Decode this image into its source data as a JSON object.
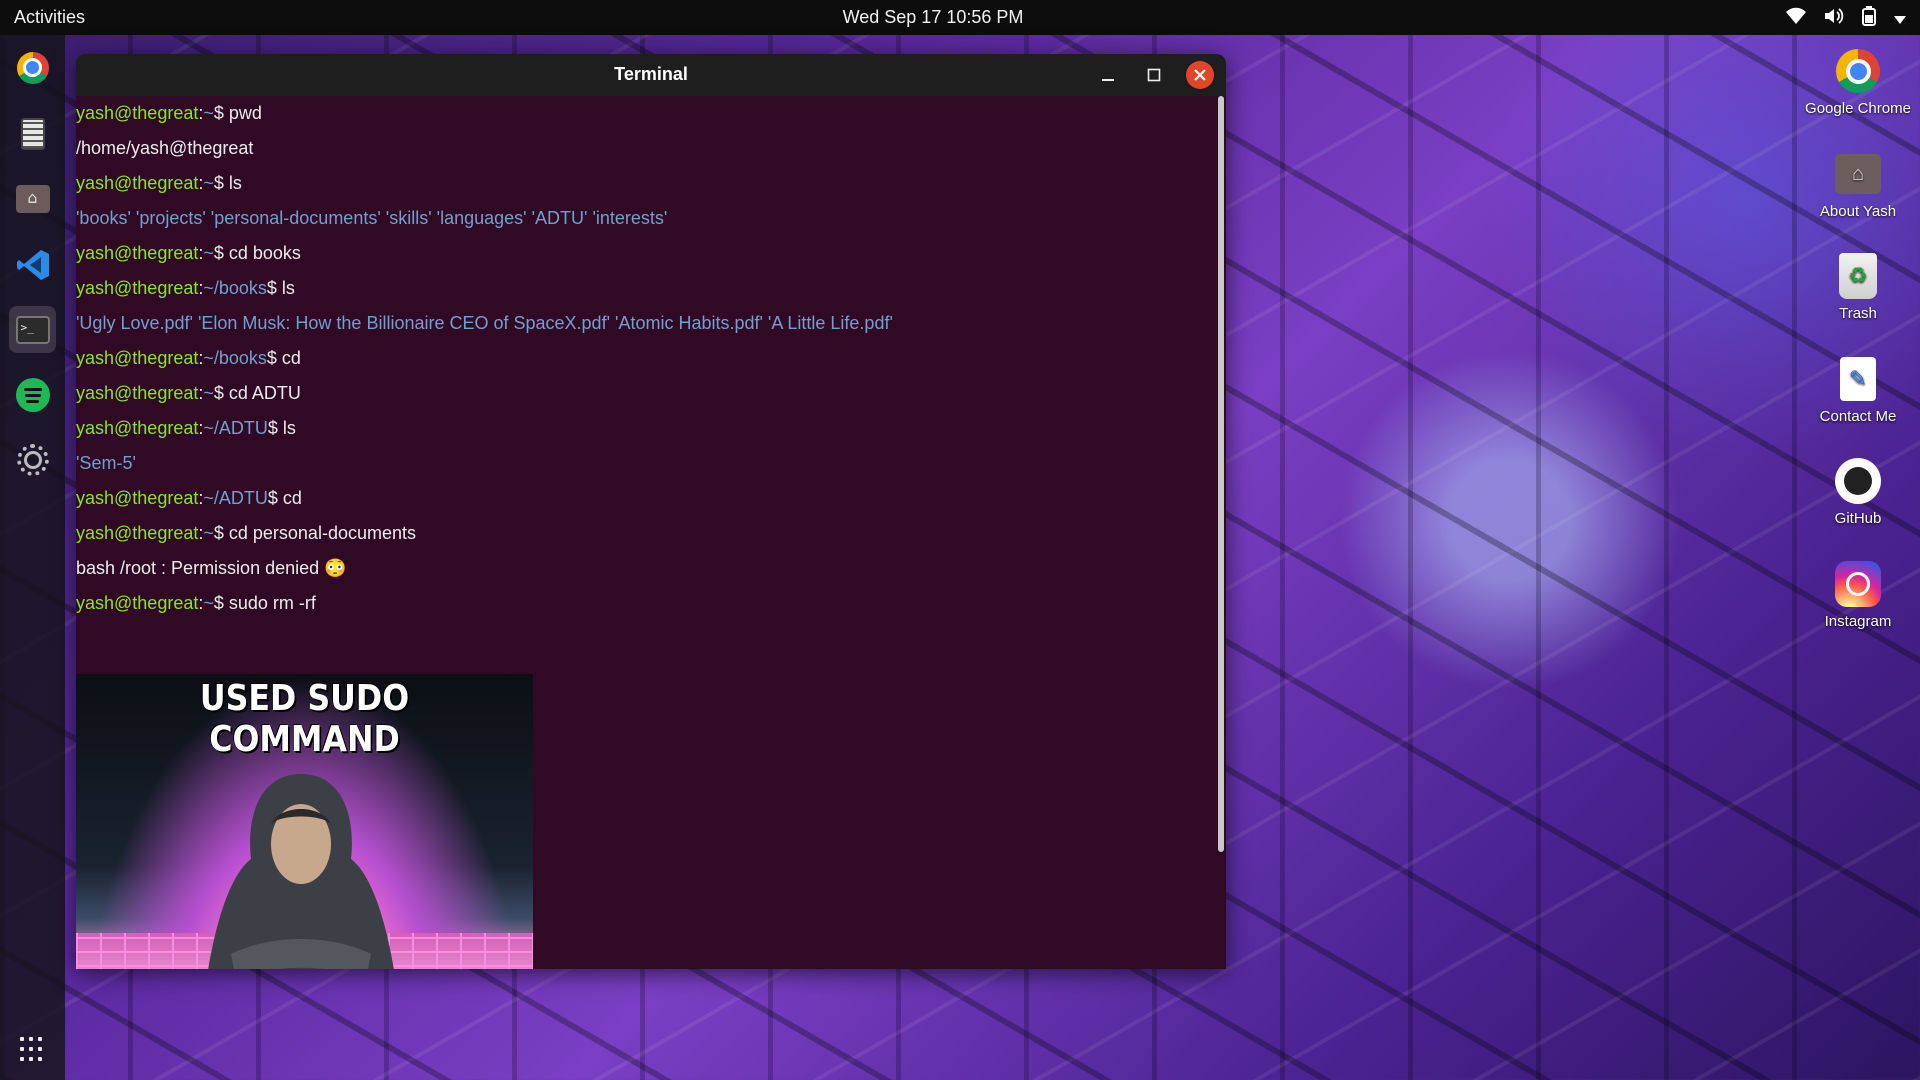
{
  "topbar": {
    "activities": "Activities",
    "clock": "Wed Sep 17 10:56 PM"
  },
  "dock": {
    "items": [
      "chrome",
      "calculator",
      "files",
      "vscode",
      "terminal",
      "spotify",
      "settings"
    ],
    "active": "terminal"
  },
  "terminal": {
    "title": "Terminal",
    "user": "yash@thegreat",
    "lines": [
      {
        "type": "prompt",
        "path": "~",
        "cmd": "pwd"
      },
      {
        "type": "output",
        "text": "/home/yash@thegreat"
      },
      {
        "type": "prompt",
        "path": "~",
        "cmd": "ls"
      },
      {
        "type": "ls",
        "text": "'books'  'projects'  'personal-documents'  'skills'  'languages'  'ADTU'  'interests'"
      },
      {
        "type": "prompt",
        "path": "~",
        "cmd": "cd books"
      },
      {
        "type": "prompt",
        "path": "~/books",
        "cmd": "ls"
      },
      {
        "type": "ls",
        "text": "'Ugly Love.pdf'  'Elon Musk: How the Billionaire CEO of SpaceX.pdf'  'Atomic Habits.pdf'  'A Little Life.pdf'"
      },
      {
        "type": "prompt",
        "path": "~/books",
        "cmd": "cd"
      },
      {
        "type": "prompt",
        "path": "~",
        "cmd": "cd ADTU"
      },
      {
        "type": "prompt",
        "path": "~/ADTU",
        "cmd": "ls"
      },
      {
        "type": "ls",
        "text": "'Sem-5'"
      },
      {
        "type": "prompt",
        "path": "~/ADTU",
        "cmd": "cd"
      },
      {
        "type": "prompt",
        "path": "~",
        "cmd": "cd personal-documents"
      },
      {
        "type": "output",
        "text": "bash /root : Permission denied 😳"
      },
      {
        "type": "prompt",
        "path": "~",
        "cmd": "sudo rm -rf"
      }
    ],
    "meme_caption": "USED SUDO COMMAND"
  },
  "desktop_icons": [
    {
      "label": "Google Chrome",
      "icon": "chrome-icon"
    },
    {
      "label": "About Yash",
      "icon": "home-folder-icon"
    },
    {
      "label": "Trash",
      "icon": "trash-icon"
    },
    {
      "label": "Contact Me",
      "icon": "note-icon"
    },
    {
      "label": "GitHub",
      "icon": "github-icon"
    },
    {
      "label": "Instagram",
      "icon": "instagram-icon"
    }
  ],
  "colors": {
    "terminal_bg": "#300a24",
    "prompt_user": "#8ae234",
    "prompt_path": "#729fcf",
    "close_button": "#e0462a"
  }
}
